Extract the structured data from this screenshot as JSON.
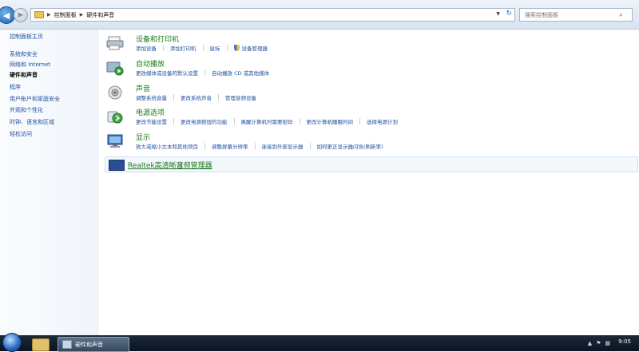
{
  "address_bar": {
    "breadcrumbs": [
      "控制面板",
      "硬件和声音"
    ],
    "search_placeholder": "搜索控制面板"
  },
  "sidebar": {
    "home": "控制面板主页",
    "items": [
      {
        "label": "系统和安全",
        "active": false
      },
      {
        "label": "网络和 Internet",
        "active": false
      },
      {
        "label": "硬件和声音",
        "active": true
      },
      {
        "label": "程序",
        "active": false
      },
      {
        "label": "用户帐户和家庭安全",
        "active": false
      },
      {
        "label": "外观和个性化",
        "active": false
      },
      {
        "label": "时钟、语言和区域",
        "active": false
      },
      {
        "label": "轻松访问",
        "active": false
      }
    ]
  },
  "categories": [
    {
      "title": "设备和打印机",
      "icon": "printer-icon",
      "links": [
        "添加设备",
        "添加打印机",
        "鼠标",
        "设备管理器"
      ]
    },
    {
      "title": "自动播放",
      "icon": "autoplay-icon",
      "links": [
        "更改媒体或设备的默认设置",
        "自动播放 CD 或其他媒体"
      ]
    },
    {
      "title": "声音",
      "icon": "speaker-icon",
      "links": [
        "调整系统音量",
        "更改系统声音",
        "管理音频设备"
      ]
    },
    {
      "title": "电源选项",
      "icon": "power-icon",
      "links": [
        "更改节能设置",
        "更改电源按钮的功能",
        "唤醒计算机时需要密码",
        "更改计算机睡眠时间",
        "选择电源计划"
      ]
    },
    {
      "title": "显示",
      "icon": "display-icon",
      "links": [
        "放大或缩小文本和其他项目",
        "调整屏幕分辨率",
        "连接到外部显示器",
        "如何更正显示器闪烁(刷新率)"
      ]
    }
  ],
  "realtek": {
    "title": "Realtek高清晰音频管理器"
  },
  "taskbar": {
    "task_label": "硬件和声音",
    "clock": "9:05"
  }
}
